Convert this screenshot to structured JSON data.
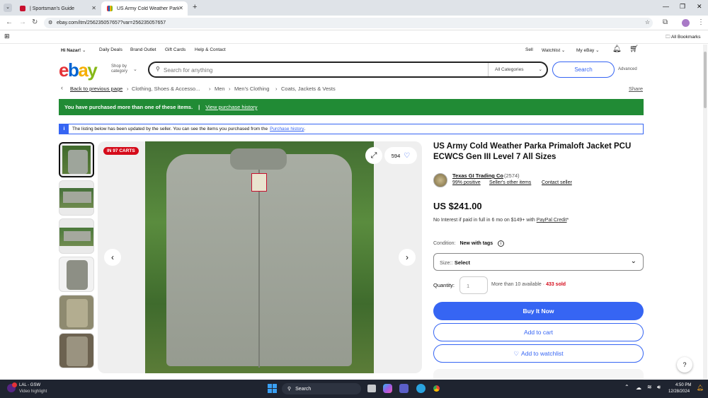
{
  "browser": {
    "tabs": [
      {
        "label": "| Sportsman's Guide",
        "active": false
      },
      {
        "label": "US Army Cold Weather Parka P",
        "active": true
      }
    ],
    "url": "ebay.com/itm/256235057657?var=256235057657",
    "bookmarks_label": "All Bookmarks"
  },
  "ebay": {
    "topnav": {
      "greeting": "Hi Nazar!",
      "links": [
        "Daily Deals",
        "Brand Outlet",
        "Gift Cards",
        "Help & Contact"
      ],
      "right": [
        "Sell",
        "Watchlist",
        "My eBay"
      ]
    },
    "logo": [
      "e",
      "b",
      "a",
      "y"
    ],
    "logo_colors": [
      "#e53238",
      "#0064d2",
      "#f5af02",
      "#86b817"
    ],
    "shop_by_category": "Shop by category",
    "search": {
      "placeholder": "Search for anything",
      "category": "All Categories",
      "button": "Search",
      "advanced": "Advanced"
    },
    "breadcrumb": {
      "back": "Back to previous page",
      "items": [
        "Clothing, Shoes & Accesso...",
        "Men",
        "Men's Clothing",
        "Coats, Jackets & Vests"
      ],
      "share": "Share"
    },
    "purchase_banner": {
      "text": "You have purchased more than one of these items.",
      "link": "View purchase history"
    },
    "info_banner": {
      "text": "The listing below has been updated by the seller. You can see the items you purchased from the",
      "link": "Purchase history",
      "end": "."
    },
    "gallery": {
      "cart_badge": "IN 97 CARTS",
      "watch_count": "594"
    },
    "item": {
      "title": "US Army Cold Weather Parka Primaloft Jacket PCU ECWCS Gen III Level 7 All Sizes",
      "seller_name": "Texas GI Trading Co",
      "seller_feedback": "(2574)",
      "seller_positive": "99% positive",
      "seller_other": "Seller's other items",
      "seller_contact": "Contact seller",
      "price": "US $241.00",
      "credit_text": "No Interest if paid in full in 6 mo on $149+ with",
      "credit_link": "PayPal Credit",
      "credit_suffix": "*",
      "condition_label": "Condition:",
      "condition_value": "New with tags",
      "size_label": "Size::",
      "size_value": "Select",
      "quantity_label": "Quantity:",
      "quantity_value": "1",
      "availability": "More than 10 available",
      "sold": "433 sold",
      "buy_now": "Buy It Now",
      "add_cart": "Add to cart",
      "add_watch": "Add to watchlist"
    },
    "help": "?"
  },
  "taskbar": {
    "weather_title": "LAL - GSW",
    "weather_sub": "Video highlight",
    "search": "Search",
    "time": "4:50 PM",
    "date": "12/28/2024"
  }
}
